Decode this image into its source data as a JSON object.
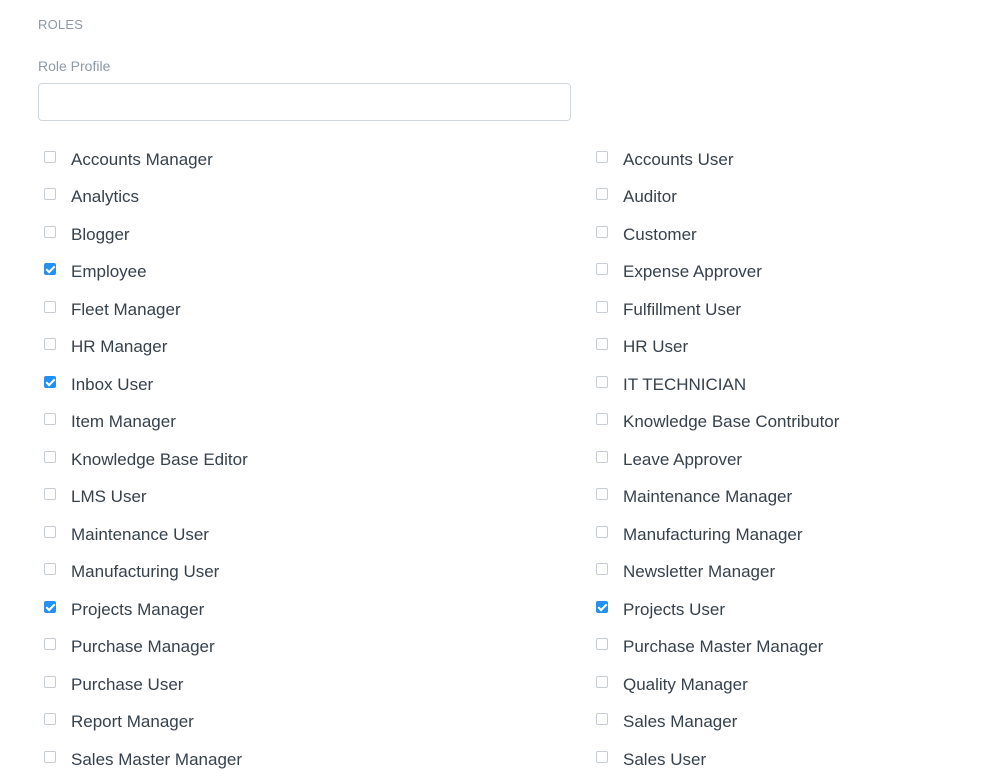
{
  "section": {
    "heading": "ROLES"
  },
  "role_profile": {
    "label": "Role Profile",
    "value": "",
    "placeholder": ""
  },
  "colors": {
    "accent": "#2490ef",
    "label": "#8d99a6",
    "text": "#36414c",
    "border": "#d1d8dd"
  },
  "roles": [
    {
      "label": "Accounts Manager",
      "checked": false
    },
    {
      "label": "Accounts User",
      "checked": false
    },
    {
      "label": "Analytics",
      "checked": false
    },
    {
      "label": "Auditor",
      "checked": false
    },
    {
      "label": "Blogger",
      "checked": false
    },
    {
      "label": "Customer",
      "checked": false
    },
    {
      "label": "Employee",
      "checked": true
    },
    {
      "label": "Expense Approver",
      "checked": false
    },
    {
      "label": "Fleet Manager",
      "checked": false
    },
    {
      "label": "Fulfillment User",
      "checked": false
    },
    {
      "label": "HR Manager",
      "checked": false
    },
    {
      "label": "HR User",
      "checked": false
    },
    {
      "label": "Inbox User",
      "checked": true
    },
    {
      "label": "IT TECHNICIAN",
      "checked": false
    },
    {
      "label": "Item Manager",
      "checked": false
    },
    {
      "label": "Knowledge Base Contributor",
      "checked": false
    },
    {
      "label": "Knowledge Base Editor",
      "checked": false
    },
    {
      "label": "Leave Approver",
      "checked": false
    },
    {
      "label": "LMS User",
      "checked": false
    },
    {
      "label": "Maintenance Manager",
      "checked": false
    },
    {
      "label": "Maintenance User",
      "checked": false
    },
    {
      "label": "Manufacturing Manager",
      "checked": false
    },
    {
      "label": "Manufacturing User",
      "checked": false
    },
    {
      "label": "Newsletter Manager",
      "checked": false
    },
    {
      "label": "Projects Manager",
      "checked": true
    },
    {
      "label": "Projects User",
      "checked": true
    },
    {
      "label": "Purchase Manager",
      "checked": false
    },
    {
      "label": "Purchase Master Manager",
      "checked": false
    },
    {
      "label": "Purchase User",
      "checked": false
    },
    {
      "label": "Quality Manager",
      "checked": false
    },
    {
      "label": "Report Manager",
      "checked": false
    },
    {
      "label": "Sales Manager",
      "checked": false
    },
    {
      "label": "Sales Master Manager",
      "checked": false
    },
    {
      "label": "Sales User",
      "checked": false
    }
  ]
}
